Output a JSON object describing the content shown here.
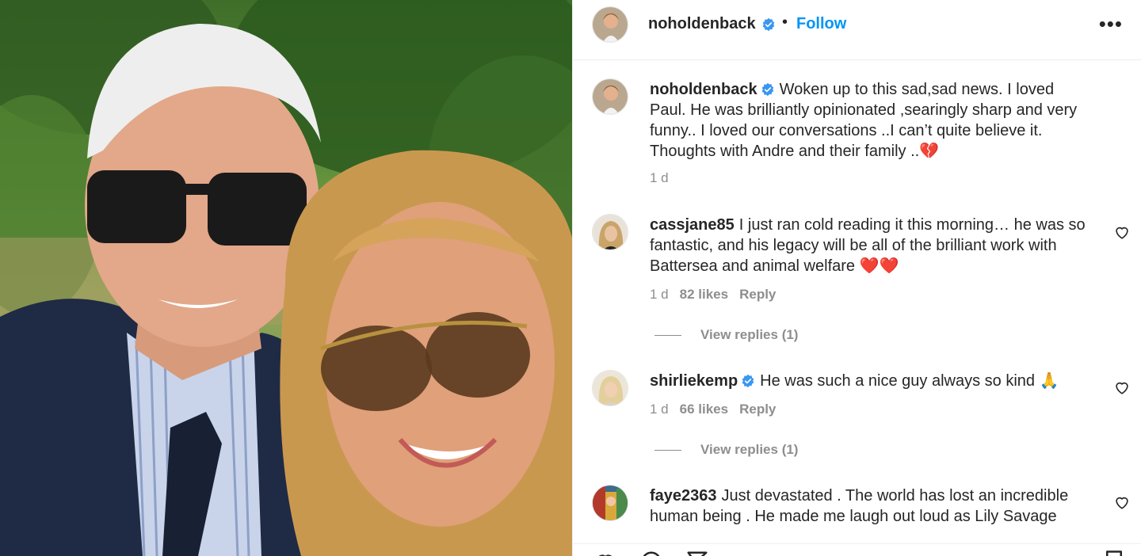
{
  "post": {
    "author": "noholdenback",
    "follow_label": "Follow",
    "more_label": "•••",
    "separator": "•"
  },
  "caption": {
    "username": "noholdenback",
    "text": "Woken up to this sad,sad news. I loved Paul. He was brilliantly opinionated ,searingly sharp and very funny.. I loved our conversations ..I can’t quite believe it. Thoughts with Andre and their family ..💔",
    "time": "1 d"
  },
  "comments": [
    {
      "username": "cassjane85",
      "verified": false,
      "text": "I just ran cold reading it this morning… he was so fantastic, and his legacy will be all of the brilliant work with Battersea and animal welfare ❤️❤️",
      "time": "1 d",
      "likes": "82 likes",
      "reply_label": "Reply",
      "view_replies": "View replies (1)"
    },
    {
      "username": "shirliekemp",
      "verified": true,
      "text": "He was such a nice guy always so kind 🙏",
      "time": "1 d",
      "likes": "66 likes",
      "reply_label": "Reply",
      "view_replies": "View replies (1)"
    },
    {
      "username": "faye2363",
      "verified": false,
      "text": "Just devastated . The world has lost an incredible human being . He made me laugh out loud as Lily Savage"
    }
  ],
  "icons": {
    "verified": "verified-badge-icon",
    "like": "heart-icon",
    "comment": "comment-icon",
    "share": "share-icon",
    "save": "bookmark-icon",
    "more": "more-options-icon"
  },
  "colors": {
    "accent": "#0095f6",
    "secondary_text": "#8e8e8e",
    "primary_text": "#262626"
  }
}
